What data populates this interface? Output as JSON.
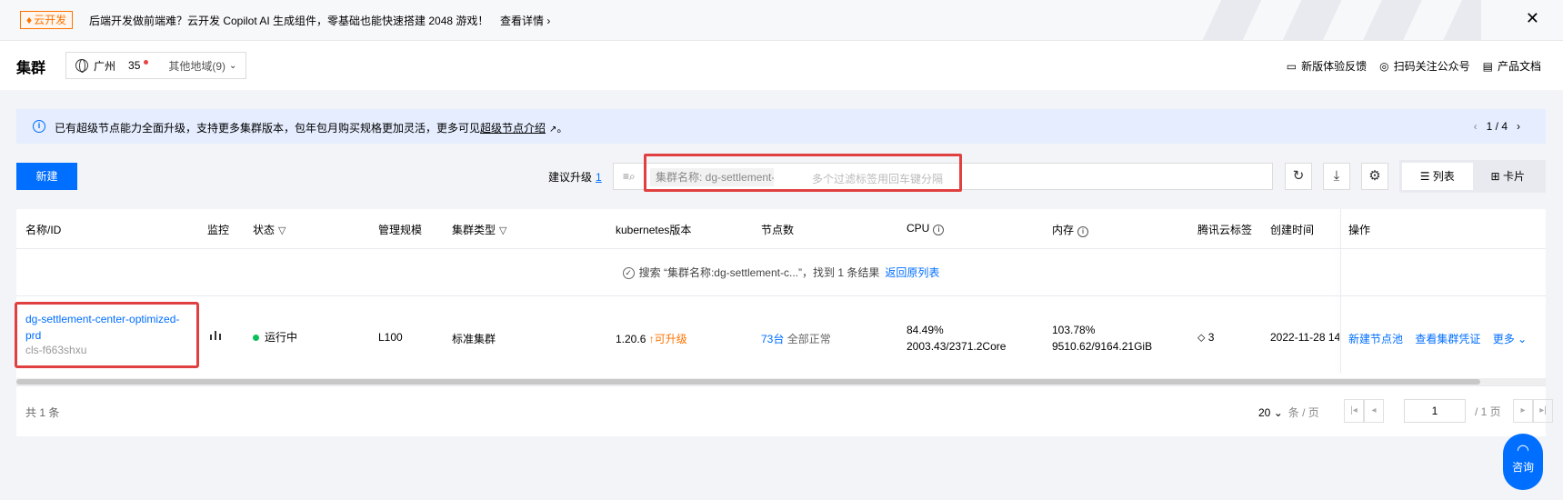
{
  "banner": {
    "tag": "云开发",
    "text": "后端开发做前端难？云开发 Copilot AI 生成组件，零基础也能快速搭建 2048 游戏！",
    "link": "查看详情 ›"
  },
  "header": {
    "title": "集群",
    "region": {
      "name": "广州",
      "count": "35",
      "other": "其他地域(9)"
    },
    "links": [
      "新版体验反馈",
      "扫码关注公众号",
      "产品文档"
    ]
  },
  "notice": {
    "text_before": "已有超级节点能力全面升级，支持更多集群版本，包年包月购买规格更加灵活，更多可见",
    "link": "超级节点介绍",
    "text_after": "。",
    "pager": "1 / 4"
  },
  "toolbar": {
    "new_label": "新建",
    "upgrade_label": "建议升级",
    "upgrade_count": "1",
    "search_tag": "集群名称: dg-settlement-c...",
    "search_placeholder": "多个过滤标签用回车键分隔",
    "view_list": "列表",
    "view_card": "卡片"
  },
  "table": {
    "headers": {
      "name": "名称/ID",
      "monitor": "监控",
      "status": "状态",
      "scale": "管理规模",
      "type": "集群类型",
      "k8s": "kubernetes版本",
      "nodes": "节点数",
      "cpu": "CPU",
      "mem": "内存",
      "tags": "腾讯云标签",
      "created": "创建时间",
      "ops": "操作"
    },
    "search_result": {
      "text": "搜索 “集群名称:dg-settlement-c...”，找到 1 条结果",
      "back": "返回原列表"
    },
    "rows": [
      {
        "name_line1": "dg-settlement-center-optimized-",
        "name_line2": "prd",
        "id": "cls-f663shxu",
        "status": "运行中",
        "scale": "L100",
        "type": "标准集群",
        "k8s_version": "1.20.6",
        "upgrade": "可升级",
        "nodes_count": "73台",
        "nodes_status": "全部正常",
        "cpu_pct": "84.49%",
        "cpu_detail": "2003.43/2371.2Core",
        "mem_pct": "103.78%",
        "mem_detail": "9510.62/9164.21GiB",
        "tags_count": "3",
        "created": "2022-11-28 14",
        "op1": "新建节点池",
        "op2": "查看集群凭证",
        "op3": "更多"
      }
    ],
    "footer": {
      "total": "共 1 条",
      "page_size": "20",
      "page_size_unit": "条 / 页",
      "page": "1",
      "page_total": "/ 1 页"
    }
  },
  "consult_label": "咨询",
  "colors": {
    "primary": "#006eff",
    "warning": "#ff7200",
    "success": "#0abf5b",
    "highlight": "#e04040"
  }
}
